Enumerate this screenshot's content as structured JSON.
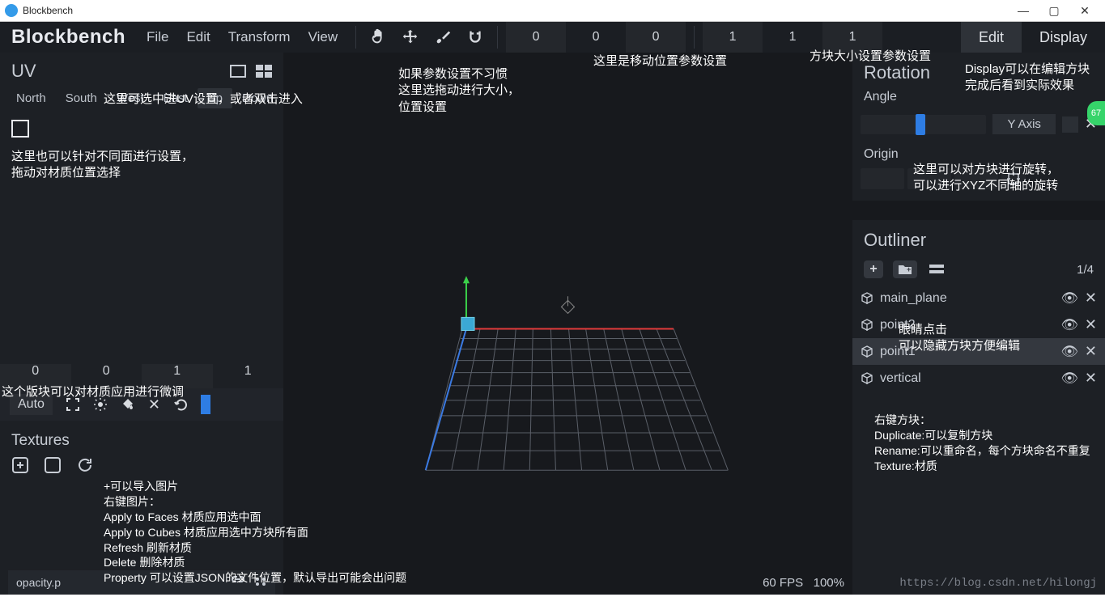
{
  "title_bar": {
    "title": "Blockbench"
  },
  "toolbar": {
    "brand": "Blockbench",
    "menus": [
      "File",
      "Edit",
      "Transform",
      "View"
    ],
    "pos": [
      "0",
      "0",
      "0"
    ],
    "size": [
      "1",
      "1",
      "1"
    ],
    "modes": {
      "edit": "Edit",
      "display": "Display"
    }
  },
  "uv": {
    "title": "UV",
    "faces": [
      "North",
      "South",
      "West",
      "East",
      "Up",
      "Down"
    ],
    "selected_face": "Up",
    "nums": [
      "0",
      "0",
      "1",
      "1"
    ],
    "auto": "Auto"
  },
  "textures": {
    "title": "Textures",
    "opacity": "opacity.p"
  },
  "rotation": {
    "title": "Rotation",
    "angle_label": "Angle",
    "axis": "Y Axis",
    "origin_label": "Origin"
  },
  "outliner": {
    "title": "Outliner",
    "count": "1/4",
    "items": [
      {
        "name": "main_plane",
        "selected": false
      },
      {
        "name": "point2",
        "selected": false
      },
      {
        "name": "point1",
        "selected": true
      },
      {
        "name": "vertical",
        "selected": false
      }
    ]
  },
  "status": {
    "fps": "60 FPS",
    "zoom": "100%"
  },
  "watermark": "https://blog.csdn.net/hilongj",
  "badge": "67",
  "annot": {
    "uv_hint": "这里可选中进UV设置，或者双击进入",
    "face_hint": "这里也可以针对不同面进行设置，\n拖动对材质位置选择",
    "material_hint": "这个版块可以对材质应用进行微调",
    "tex_hint": "+可以导入图片\n右键图片：\nApply to Faces 材质应用选中面\nApply to Cubes 材质应用选中方块所有面\nRefresh 刷新材质\nDelete 删除材质\nProperty 可以设置JSON的文件位置，默认导出可能会出问题",
    "drag_hint": "如果参数设置不习惯\n这里选拖动进行大小，\n位置设置",
    "pos_hint": "这里是移动位置参数设置",
    "size_hint": "方块大小设置参数设置",
    "display_hint": "Display可以在编辑方块\n完成后看到实际效果",
    "rotate_hint": "这里可以对方块进行旋转，\n可以进行XYZ不同轴的旋转",
    "eye_hint": "眼睛点击\n可以隐藏方块方便编辑",
    "rclick_hint": "右键方块：\nDuplicate:可以复制方块\nRename:可以重命名，每个方块命名不重复\nTexture:材质"
  }
}
